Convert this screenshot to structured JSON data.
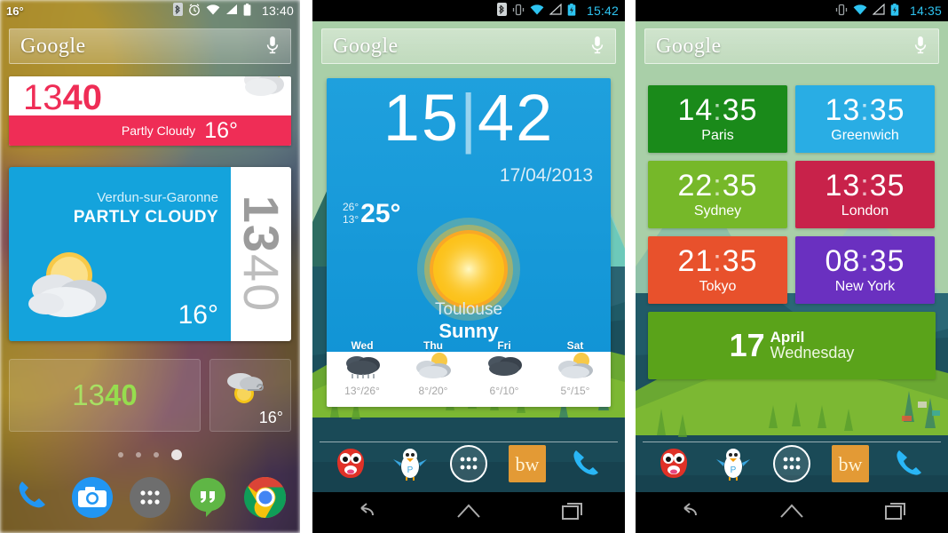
{
  "panel1": {
    "statusbar": {
      "temp_left": "16°",
      "clock": "13:40",
      "icons": [
        "bluetooth-icon",
        "alarm-icon",
        "wifi-icon",
        "signal-icon",
        "battery-icon"
      ]
    },
    "search": {
      "logo": "Google",
      "mic": "microphone-icon"
    },
    "pink_widget": {
      "hours": "13",
      "minutes": "40",
      "condition": "Partly Cloudy",
      "temp": "16°",
      "icon": "partly-cloudy-icon"
    },
    "blue_widget": {
      "city": "Verdun-sur-Garonne",
      "condition": "PARTLY CLOUDY",
      "temp": "16°",
      "icon": "sun-behind-cloud-icon",
      "side_hours": "13",
      "side_minutes": "40"
    },
    "glass_clock": {
      "hours": "13",
      "minutes": "40"
    },
    "glass_weather": {
      "temp": "16°",
      "icon": "windy-cloud-sun-icon"
    },
    "page_dots": {
      "count": 4,
      "active_index": 3
    },
    "dock": [
      {
        "name": "phone-icon",
        "label": "Phone"
      },
      {
        "name": "camera-icon",
        "label": "Camera"
      },
      {
        "name": "app-drawer-icon",
        "label": "Apps"
      },
      {
        "name": "hangouts-icon",
        "label": "Hangouts"
      },
      {
        "name": "chrome-icon",
        "label": "Chrome"
      }
    ]
  },
  "panel2": {
    "statusbar": {
      "clock": "15:42",
      "icons": [
        "bluetooth-icon",
        "vibrate-icon",
        "wifi-icon",
        "signal-icon",
        "battery-charging-icon"
      ]
    },
    "search": {
      "logo": "Google",
      "mic": "microphone-icon"
    },
    "weather_widget": {
      "hours": "15",
      "minutes": "42",
      "date": "17/04/2013",
      "high": "26°",
      "low": "13°",
      "current_temp": "25°",
      "city": "Toulouse",
      "condition": "Sunny",
      "icon": "sun-icon",
      "forecast": [
        {
          "day": "Wed",
          "temps": "13°/26°",
          "icon": "rain-icon"
        },
        {
          "day": "Thu",
          "temps": "8°/20°",
          "icon": "partly-cloudy-icon"
        },
        {
          "day": "Fri",
          "temps": "6°/10°",
          "icon": "cloud-icon"
        },
        {
          "day": "Sat",
          "temps": "5°/15°",
          "icon": "partly-cloudy-icon"
        }
      ]
    },
    "dock": [
      {
        "name": "monster-app-icon",
        "label": "Monster"
      },
      {
        "name": "bird-app-icon",
        "label": "Bird"
      },
      {
        "name": "app-drawer-icon",
        "label": "Apps"
      },
      {
        "name": "bw-app-icon",
        "label": "bw"
      },
      {
        "name": "phone-icon",
        "label": "Phone"
      }
    ],
    "navbar": [
      "back-icon",
      "home-icon",
      "recents-icon"
    ]
  },
  "panel3": {
    "statusbar": {
      "clock": "14:35",
      "icons": [
        "vibrate-icon",
        "wifi-icon",
        "signal-icon",
        "battery-charging-icon"
      ]
    },
    "search": {
      "logo": "Google",
      "mic": "microphone-icon"
    },
    "clock_tiles": [
      {
        "time": "14:35",
        "label": "Paris",
        "color": "#1a8a1a"
      },
      {
        "time": "13:35",
        "label": "Greenwich",
        "color": "#29ade4"
      },
      {
        "time": "22:35",
        "label": "Sydney",
        "color": "#76b829"
      },
      {
        "time": "13:35",
        "label": "London",
        "color": "#c8224a"
      },
      {
        "time": "21:35",
        "label": "Tokyo",
        "color": "#e8512c"
      },
      {
        "time": "08:35",
        "label": "New York",
        "color": "#6a30c0"
      }
    ],
    "date_tile": {
      "day": "17",
      "month": "April",
      "weekday": "Wednesday",
      "color": "#5aa31a"
    },
    "dock": [
      {
        "name": "monster-app-icon",
        "label": "Monster"
      },
      {
        "name": "bird-app-icon",
        "label": "Bird"
      },
      {
        "name": "app-drawer-icon",
        "label": "Apps"
      },
      {
        "name": "bw-app-icon",
        "label": "bw"
      },
      {
        "name": "phone-icon",
        "label": "Phone"
      }
    ],
    "navbar": [
      "back-icon",
      "home-icon",
      "recents-icon"
    ]
  }
}
